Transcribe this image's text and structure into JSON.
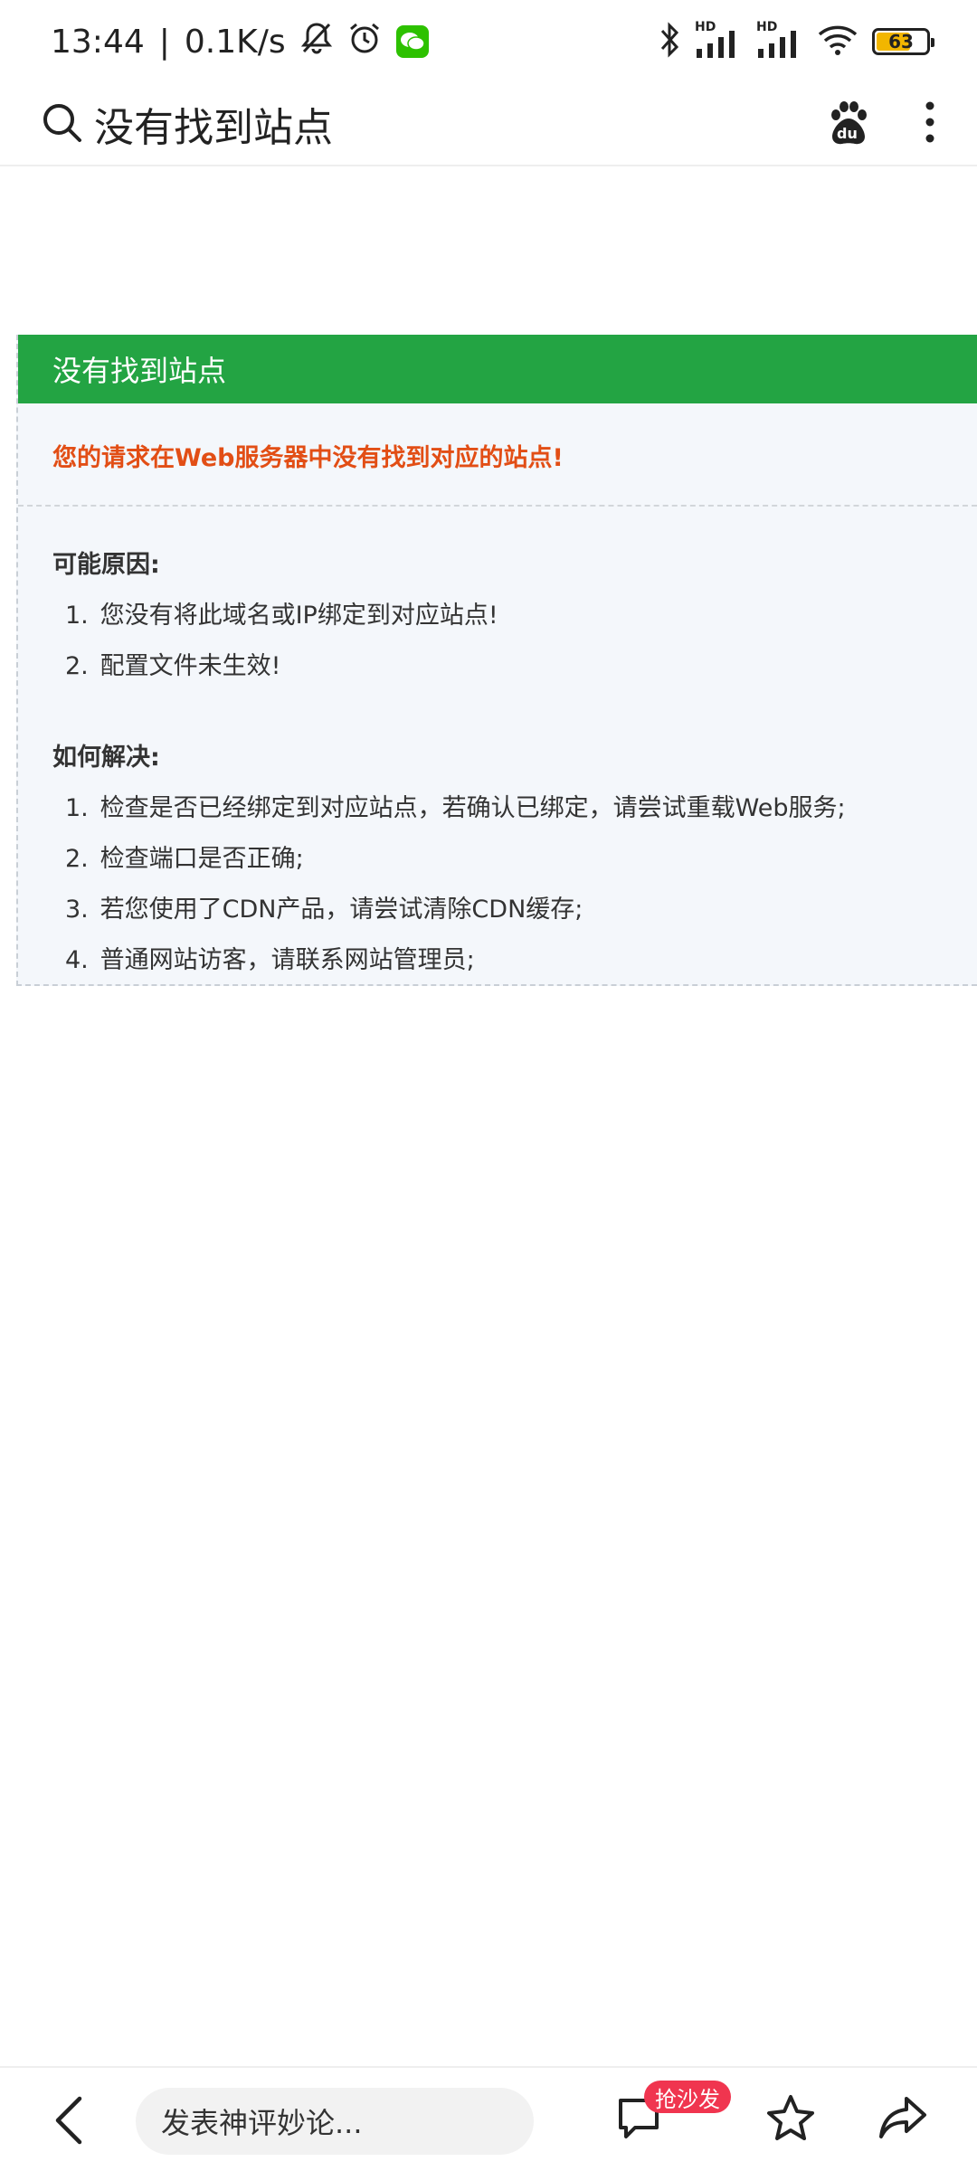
{
  "status_bar": {
    "time": "13:44",
    "separator": "|",
    "net_speed": "0.1K/s",
    "hd1": "HD",
    "hd2": "HD",
    "battery": "63",
    "battery_fraction": 0.63,
    "icons": [
      "bell-off-icon",
      "alarm-icon",
      "wechat-icon",
      "bluetooth-icon",
      "signal-icon",
      "wifi-icon",
      "battery-icon"
    ]
  },
  "top_bar": {
    "title": "没有找到站点",
    "icons": [
      "search-icon",
      "baidu-icon",
      "more-icon"
    ],
    "baidu_label": "du"
  },
  "card": {
    "header": "没有找到站点",
    "headline": "您的请求在Web服务器中没有找到对应的站点!",
    "reasons_title": "可能原因:",
    "reasons": [
      {
        "n": "1.",
        "text": "您没有将此域名或IP绑定到对应站点!"
      },
      {
        "n": "2.",
        "text": "配置文件未生效!"
      }
    ],
    "solutions_title": "如何解决:",
    "solutions": [
      {
        "n": "1.",
        "text": "检查是否已经绑定到对应站点，若确认已绑定，请尝试重载Web服务;"
      },
      {
        "n": "2.",
        "text": "检查端口是否正确;"
      },
      {
        "n": "3.",
        "text": "若您使用了CDN产品，请尝试清除CDN缓存;"
      },
      {
        "n": "4.",
        "text": "普通网站访客，请联系网站管理员;"
      }
    ]
  },
  "bottom_bar": {
    "comment_placeholder": "发表神评妙论...",
    "sofa_badge": "抢沙发",
    "icons": [
      "back-icon",
      "comment-icon",
      "star-icon",
      "share-icon"
    ]
  },
  "colors": {
    "header_green": "#23a443",
    "headline_orange": "#e24e15",
    "card_bg": "#f4f7fb",
    "badge_red": "#f0354f",
    "wechat_green": "#2dc100",
    "battery_yellow": "#f2b600"
  }
}
